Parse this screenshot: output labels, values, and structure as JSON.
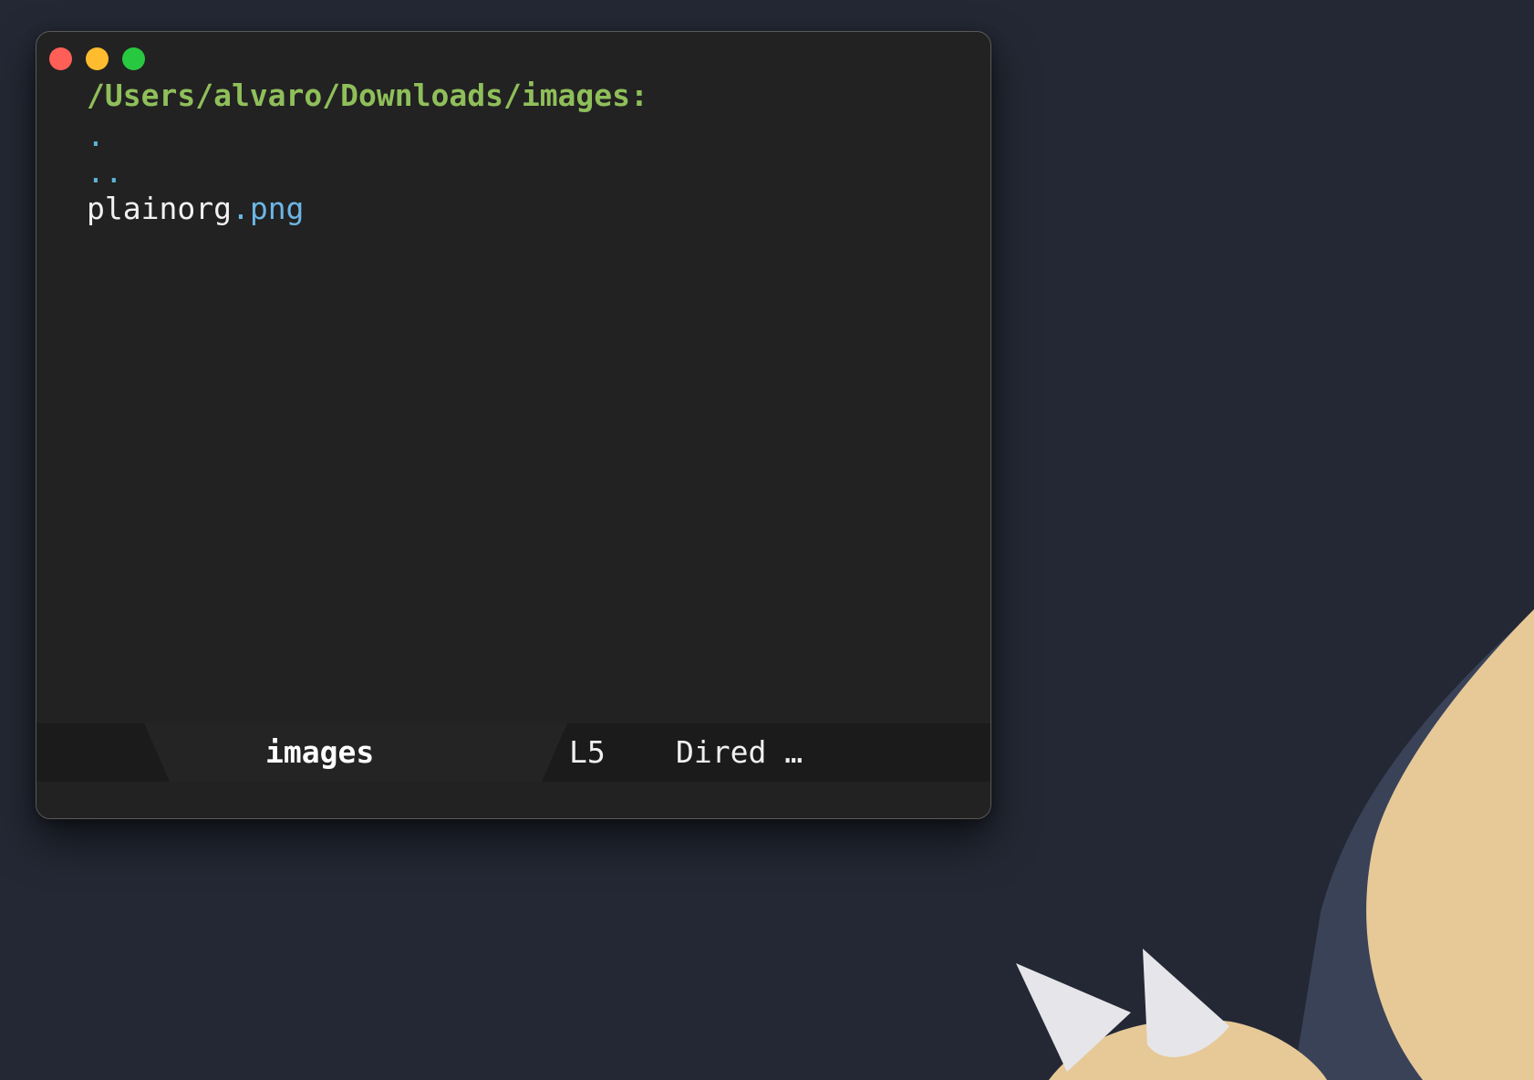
{
  "buffer": {
    "header": "/Users/alvaro/Downloads/images:",
    "entries": [
      {
        "name": ".",
        "ext": ""
      },
      {
        "name": "..",
        "ext": ""
      },
      {
        "name": "plainorg",
        "ext": ".png"
      }
    ]
  },
  "modeline": {
    "buffer_name": "images",
    "line_number": "L5",
    "major_mode": "Dired …"
  },
  "colors": {
    "desktop_bg": "#232834",
    "window_bg": "#222222",
    "header_green": "#8fbf5a",
    "dot_blue": "#5eb4d8",
    "extension_blue": "#6cb6e6",
    "close": "#ff5f57",
    "minimize": "#febc2e",
    "maximize": "#28c840"
  }
}
